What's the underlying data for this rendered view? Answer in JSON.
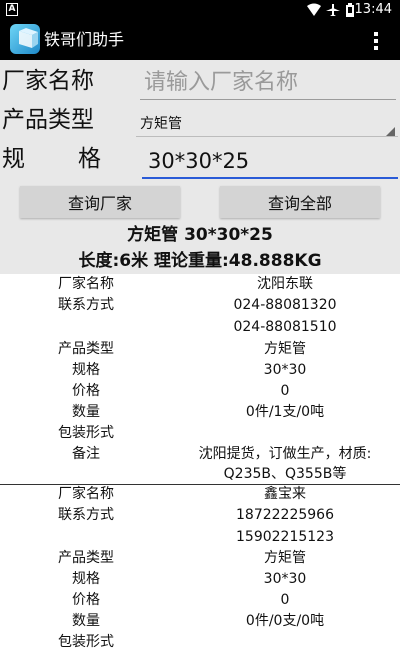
{
  "status_bar": {
    "time": "13:44",
    "notification_icon": "A"
  },
  "app": {
    "title": "铁哥们助手"
  },
  "form": {
    "manufacturer_label": "厂家名称",
    "manufacturer_placeholder": "请输入厂家名称",
    "product_type_label": "产品类型",
    "product_type_value": "方矩管",
    "spec_label_1": "规",
    "spec_label_2": "格",
    "spec_value": "30*30*25"
  },
  "buttons": {
    "query_manufacturer": "查询厂家",
    "query_all": "查询全部"
  },
  "summary": {
    "title": "方矩管 30*30*25",
    "detail": "长度:6米 理论重量:48.888KG"
  },
  "results": [
    {
      "name_label": "厂家名称",
      "name": "沈阳东联",
      "contact_label": "联系方式",
      "phones": [
        "024-88081320",
        "024-88081510"
      ],
      "type_label": "产品类型",
      "type": "方矩管",
      "spec_label": "规格",
      "spec": "30*30",
      "price_label": "价格",
      "price": "0",
      "qty_label": "数量",
      "qty": "0件/1支/0吨",
      "pack_label": "包装形式",
      "pack": "",
      "note_label": "备注",
      "note_lines": [
        "沈阳提货，订做生产，材质:",
        "Q235B、Q355B等"
      ]
    },
    {
      "name_label": "厂家名称",
      "name": "鑫宝来",
      "contact_label": "联系方式",
      "phones": [
        "18722225966",
        "15902215123"
      ],
      "type_label": "产品类型",
      "type": "方矩管",
      "spec_label": "规格",
      "spec": "30*30",
      "price_label": "价格",
      "price": "0",
      "qty_label": "数量",
      "qty": "0件/0支/0吨",
      "pack_label": "包装形式",
      "pack": ""
    }
  ],
  "icons": {
    "wifi": "wifi-icon",
    "airplane": "airplane-icon",
    "battery": "battery-icon",
    "overflow": "more-vert-icon"
  },
  "colors": {
    "bar": "#000000",
    "form_bg": "#e8e8e8",
    "button_bg": "#d4d4d4",
    "input_underline": "#2a5bd7"
  }
}
